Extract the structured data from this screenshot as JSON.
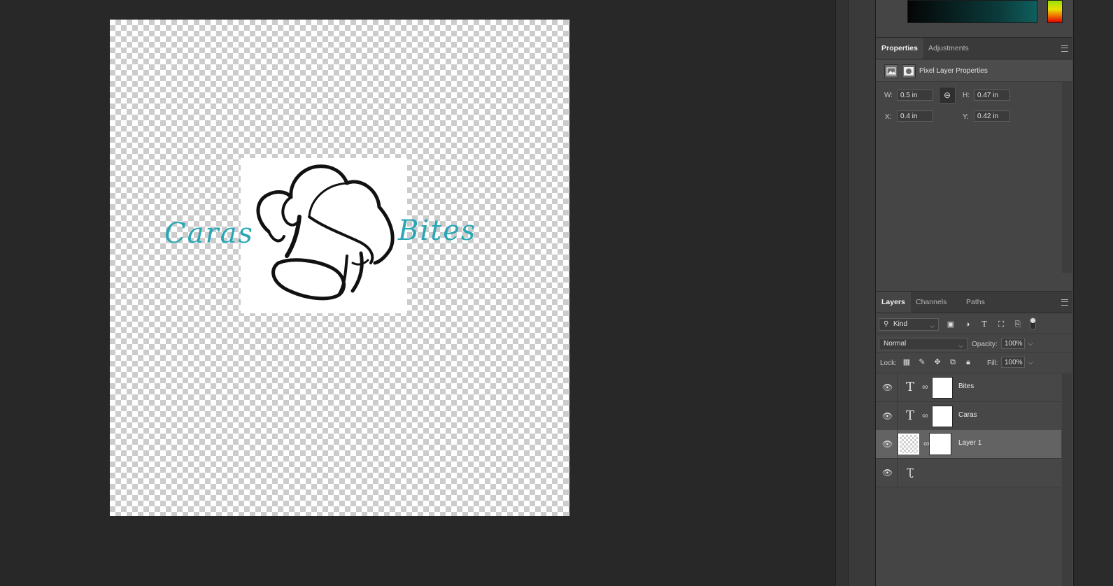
{
  "canvas": {
    "text_left": "Caras",
    "text_right": "Bites",
    "text_color": "#2aa6b5"
  },
  "properties_panel": {
    "tabs": [
      {
        "label": "Properties",
        "active": true
      },
      {
        "label": "Adjustments",
        "active": false
      }
    ],
    "header_title": "Pixel Layer Properties",
    "w_label": "W:",
    "w_value": "0.5 in",
    "h_label": "H:",
    "h_value": "0.47 in",
    "x_label": "X:",
    "x_value": "0.4 in",
    "y_label": "Y:",
    "y_value": "0.42 in"
  },
  "layers_panel": {
    "tabs": [
      {
        "label": "Layers",
        "active": true
      },
      {
        "label": "Channels",
        "active": false
      },
      {
        "label": "Paths",
        "active": false
      }
    ],
    "filter_kind": "Kind",
    "blend_mode": "Normal",
    "opacity_label": "Opacity:",
    "opacity_value": "100%",
    "lock_label": "Lock:",
    "fill_label": "Fill:",
    "fill_value": "100%",
    "layers": [
      {
        "name": "Bites",
        "type": "text",
        "visible": true,
        "selected": false
      },
      {
        "name": "Caras",
        "type": "text",
        "visible": true,
        "selected": false
      },
      {
        "name": "Layer 1",
        "type": "pixel",
        "visible": true,
        "selected": true
      },
      {
        "name": "",
        "type": "text-warp",
        "visible": true,
        "selected": false
      }
    ]
  },
  "icons": {
    "eye": "eye-icon",
    "text_layer": "text-layer-icon",
    "chain": "chain-link-icon",
    "menu": "panel-menu-icon"
  }
}
